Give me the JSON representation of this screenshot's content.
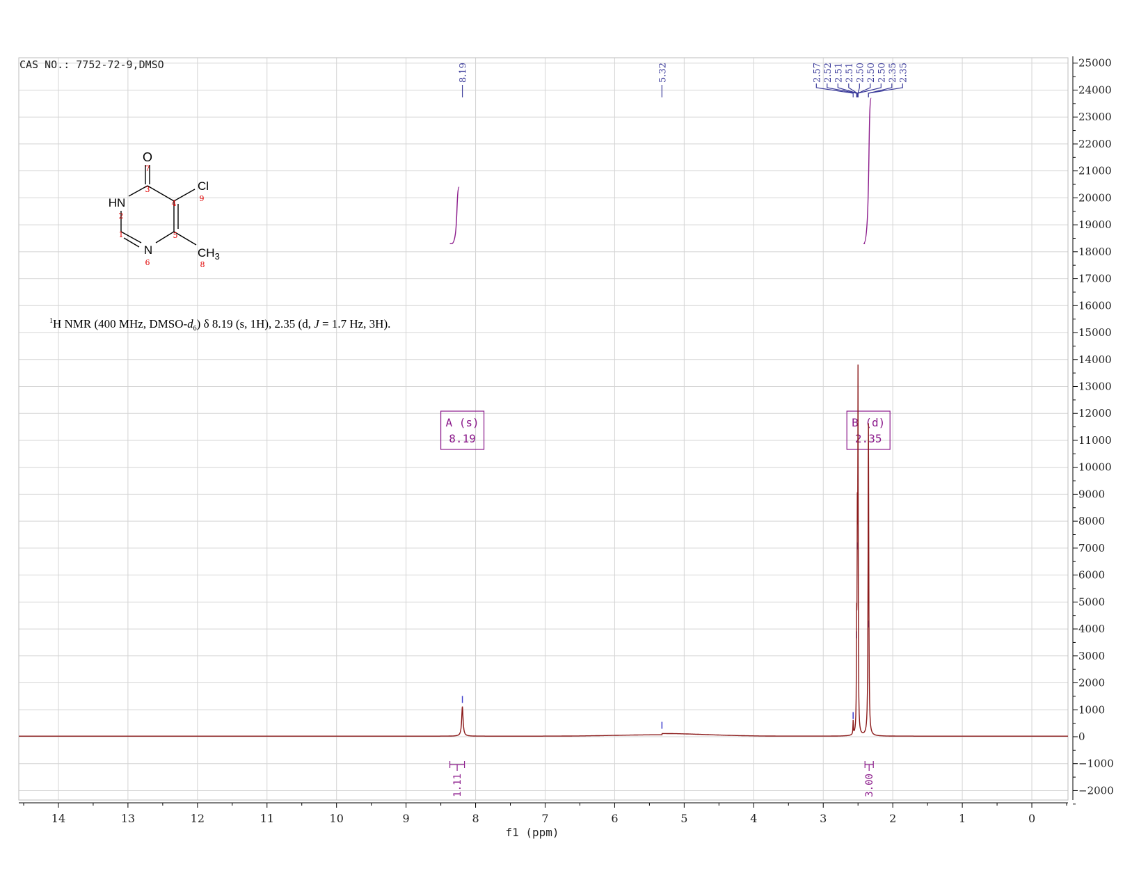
{
  "chart_data": {
    "type": "line",
    "title": "CAS NO.: 7752-72-9,DMSO",
    "xlabel": "f1 (ppm)",
    "ylabel": "",
    "xlim": [
      14.57,
      -0.52
    ],
    "ylim": [
      -2350,
      25200
    ],
    "x_reversed": true,
    "grid": true,
    "x_ticks": [
      14,
      13,
      12,
      11,
      10,
      9,
      8,
      7,
      6,
      5,
      4,
      3,
      2,
      1,
      0
    ],
    "y_ticks": [
      25000,
      24000,
      23000,
      22000,
      21000,
      20000,
      19000,
      18000,
      17000,
      16000,
      15000,
      14000,
      13000,
      12000,
      11000,
      10000,
      9000,
      8000,
      7000,
      6000,
      5000,
      4000,
      3000,
      2000,
      1000,
      0,
      -1000,
      -2000
    ],
    "y_tick_labels": [
      "25000",
      "24000",
      "23000",
      "22000",
      "21000",
      "20000",
      "19000",
      "18000",
      "17000",
      "16000",
      "15000",
      "14000",
      "13000",
      "12000",
      "11000",
      "10000",
      "9000",
      "8000",
      "7000",
      "6000",
      "5000",
      "4000",
      "3000",
      "2000",
      "1000",
      "0",
      "−1000",
      "−2000"
    ],
    "spectrum_color": "#8b1a1a",
    "peaks": [
      {
        "ppm": 8.19,
        "height": 1100,
        "width": 0.012
      },
      {
        "ppm": 5.32,
        "height": 140,
        "width": 0.45
      },
      {
        "ppm": 2.57,
        "height": 500,
        "width": 0.004
      },
      {
        "ppm": 2.52,
        "height": 3500,
        "width": 0.004
      },
      {
        "ppm": 2.51,
        "height": 6800,
        "width": 0.004
      },
      {
        "ppm": 2.5,
        "height": 9300,
        "width": 0.004
      },
      {
        "ppm": 2.5,
        "height": 3400,
        "width": 0.004
      },
      {
        "ppm": 2.35,
        "height": 7700,
        "width": 0.006
      },
      {
        "ppm": 2.35,
        "height": 3900,
        "width": 0.006
      }
    ],
    "peak_labels": {
      "color": "#3b3b9a",
      "groups": [
        {
          "labels": [
            "8.19"
          ],
          "ppm": [
            8.19
          ]
        },
        {
          "labels": [
            "5.32"
          ],
          "ppm": [
            5.32
          ]
        },
        {
          "labels": [
            "2.57",
            "2.52",
            "2.51",
            "2.51",
            "2.50",
            "2.50",
            "2.50",
            "2.35",
            "2.35"
          ],
          "ppm": [
            2.57,
            2.52,
            2.51,
            2.51,
            2.5,
            2.5,
            2.5,
            2.35,
            2.35
          ]
        }
      ]
    },
    "peak_tick_marks": [
      {
        "ppm": 8.19,
        "height": 1100
      },
      {
        "ppm": 5.32,
        "height": 140
      },
      {
        "ppm": 2.57,
        "height": 500
      },
      {
        "ppm": 2.5,
        "height": 9300
      },
      {
        "ppm": 2.51,
        "height": 6800
      },
      {
        "ppm": 2.52,
        "height": 3500
      },
      {
        "ppm": 2.35,
        "height": 7700
      },
      {
        "ppm": 2.35,
        "height": 3900
      }
    ],
    "integration_color": "#8b1a8b",
    "integrations": [
      {
        "from": 8.37,
        "to": 8.16,
        "value": "1.11",
        "curve_bottom": 18300,
        "curve_top": 20400
      },
      {
        "from": 2.4,
        "to": 2.28,
        "value": "3.00",
        "curve_bottom": 18300,
        "curve_top": 23700
      }
    ],
    "multiplets": [
      {
        "label": "A (s)",
        "shift": "8.19",
        "ppm": 8.19
      },
      {
        "label": "B (d)",
        "shift": "2.35",
        "ppm": 2.35
      }
    ],
    "annotation": {
      "sup": "1",
      "part1": "H NMR (400 MHz, DMSO-",
      "italic_d": "d",
      "sub": "6",
      "part2": ") δ 8.19 (s, 1H), 2.35 (d, ",
      "italic_j": "J",
      "part3": " = 1.7 Hz, 3H)."
    },
    "structure": {
      "atoms": {
        "o": "O",
        "cl": "Cl",
        "hn": "HN",
        "n": "N",
        "ch": "CH",
        "ch_sub": "3"
      },
      "numbers": [
        "1",
        "2",
        "3",
        "4",
        "5",
        "6",
        "7",
        "8",
        "9"
      ]
    }
  }
}
